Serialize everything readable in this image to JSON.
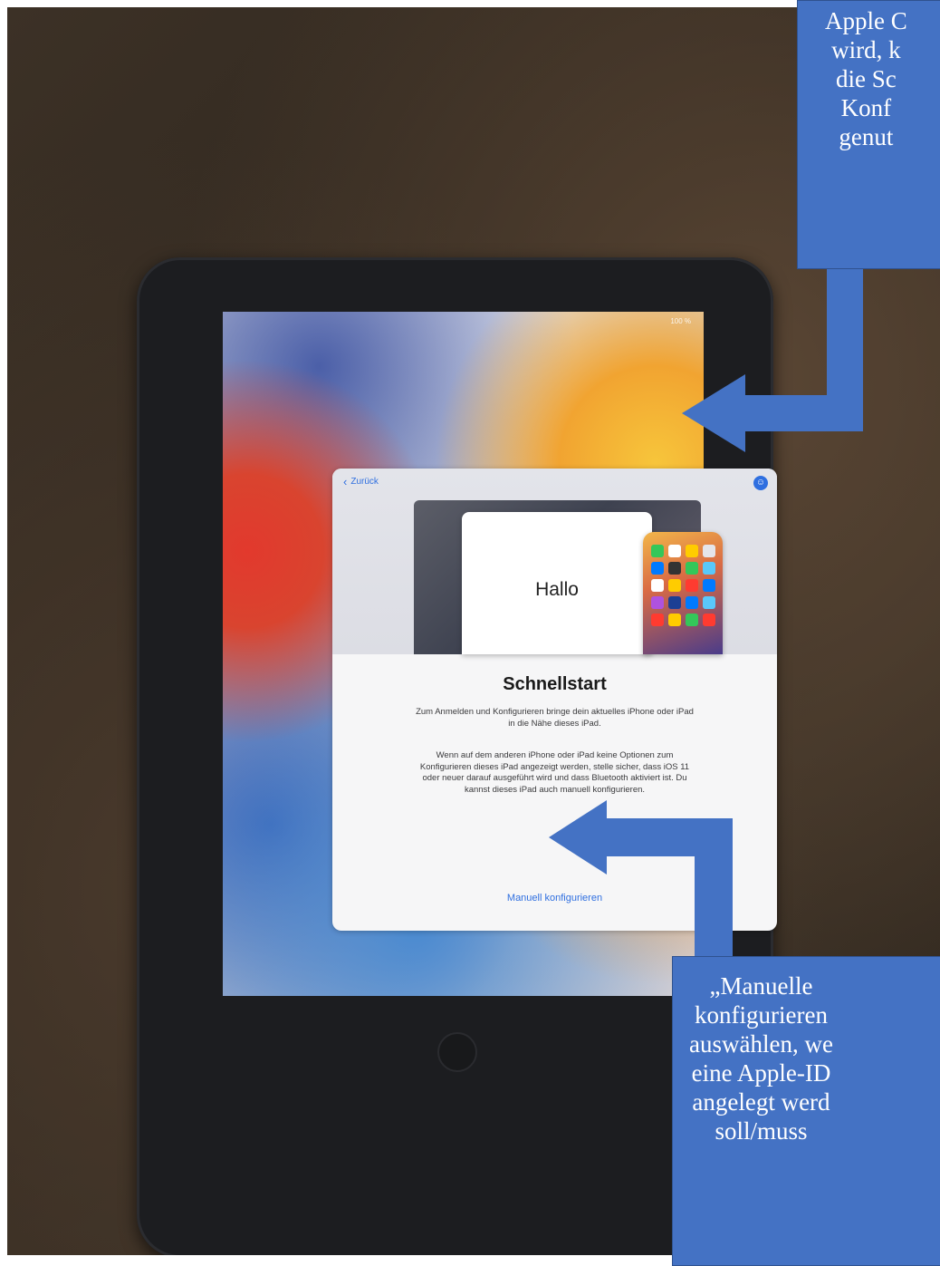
{
  "device_screen": {
    "status_text": "100 %",
    "dialog": {
      "back_label": "Zurück",
      "accessibility_icon": "accessibility-icon",
      "illustration_text": "Hallo",
      "title": "Schnellstart",
      "paragraph_1": "Zum Anmelden und Konfigurieren bringe dein aktuelles iPhone oder iPad in die Nähe dieses iPad.",
      "paragraph_2": "Wenn auf dem anderen iPhone oder iPad keine Optionen zum Konfigurieren dieses iPad angezeigt werden, stelle sicher, dass iOS 11 oder neuer darauf ausgeführt wird und dass Bluetooth aktiviert ist. Du kannst dieses iPad auch manuell konfigurieren.",
      "manual_label": "Manuell konfigurieren"
    }
  },
  "annotations": {
    "top_callout_lines": [
      "Apple C",
      "wird, k",
      "die Sc",
      "Konf",
      "genut"
    ],
    "bottom_callout_lines": [
      "„Manuelle",
      "konfigurieren",
      "auswählen, we",
      "eine Apple-ID",
      "angelegt werd",
      "soll/muss"
    ],
    "color": "#4472c4"
  }
}
